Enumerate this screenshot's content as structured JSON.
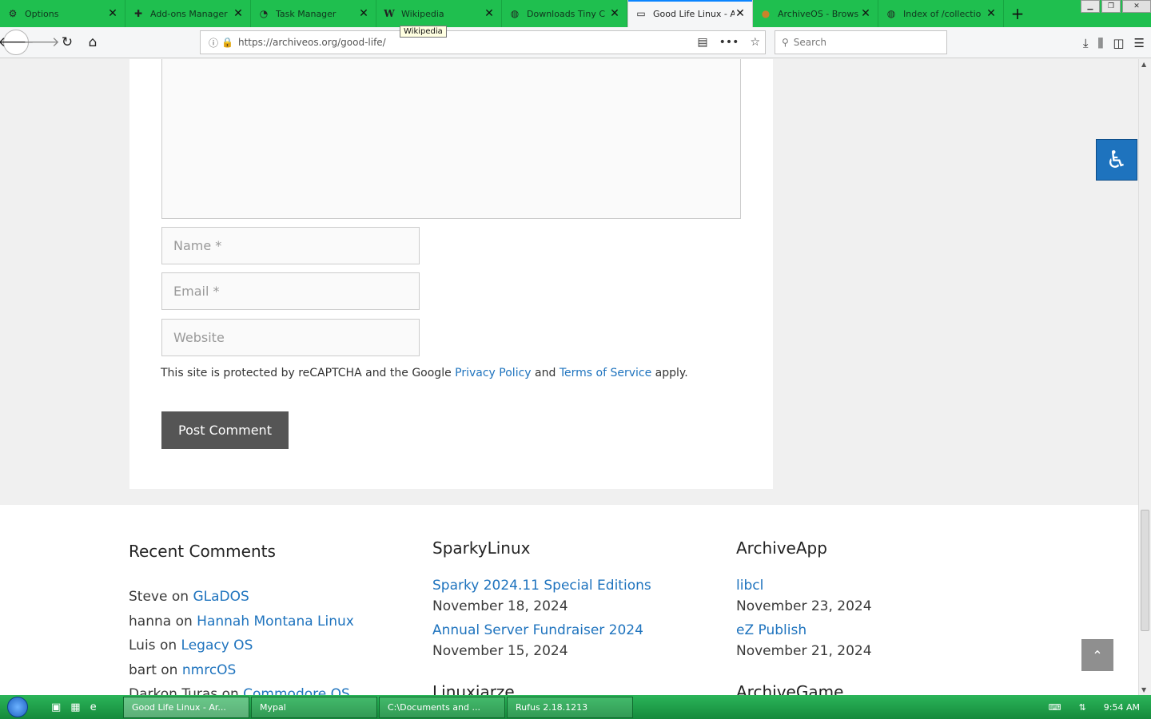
{
  "tabs": [
    {
      "label": "Options",
      "icon": "gear-icon"
    },
    {
      "label": "Add-ons Manager",
      "icon": "puzzle-icon"
    },
    {
      "label": "Task Manager",
      "icon": "gauge-icon"
    },
    {
      "label": "Wikipedia",
      "icon": "wikipedia-icon"
    },
    {
      "label": "Downloads Tiny C",
      "icon": "globe-icon"
    },
    {
      "label": "Good Life Linux - A",
      "icon": "monitor-icon",
      "active": true
    },
    {
      "label": "ArchiveOS - Brows",
      "icon": "archive-icon"
    },
    {
      "label": "Index of /collectio",
      "icon": "globe-icon"
    }
  ],
  "tooltip": "Wikipedia",
  "url": "https://archiveos.org/good-life/",
  "search_placeholder": "Search",
  "form": {
    "name_placeholder": "Name *",
    "email_placeholder": "Email *",
    "website_placeholder": "Website",
    "recaptcha_prefix": "This site is protected by reCAPTCHA and the Google",
    "privacy_link": "Privacy Policy",
    "and_text": "and",
    "terms_link": "Terms of Service",
    "apply_text": "apply.",
    "submit_label": "Post Comment"
  },
  "footer": {
    "recent_comments": {
      "title": "Recent Comments",
      "items": [
        {
          "author": "Steve",
          "on": "on",
          "post": "GLaDOS"
        },
        {
          "author": "hanna",
          "on": "on",
          "post": "Hannah Montana Linux"
        },
        {
          "author": "Luis",
          "on": "on",
          "post": "Legacy OS"
        },
        {
          "author": "bart",
          "on": "on",
          "post": "nmrcOS"
        },
        {
          "author": "Darkon Turas",
          "on": "on",
          "post": "Commodore OS"
        }
      ]
    },
    "sparky": {
      "title": "SparkyLinux",
      "items": [
        {
          "title": "Sparky 2024.11 Special Editions",
          "date": "November 18, 2024"
        },
        {
          "title": "Annual Server Fundraiser 2024",
          "date": "November 15, 2024"
        }
      ],
      "next_title": "Linuxiarze"
    },
    "archiveapp": {
      "title": "ArchiveApp",
      "items": [
        {
          "title": "libcl",
          "date": "November 23, 2024"
        },
        {
          "title": "eZ Publish",
          "date": "November 21, 2024"
        }
      ],
      "next_title": "ArchiveGame"
    }
  },
  "taskbar": {
    "buttons": [
      {
        "label": "Good Life Linux - Ar...",
        "active": true
      },
      {
        "label": "Mypal"
      },
      {
        "label": "C:\\Documents and ..."
      },
      {
        "label": "Rufus 2.18.1213"
      }
    ],
    "clock": "9:54 AM"
  }
}
